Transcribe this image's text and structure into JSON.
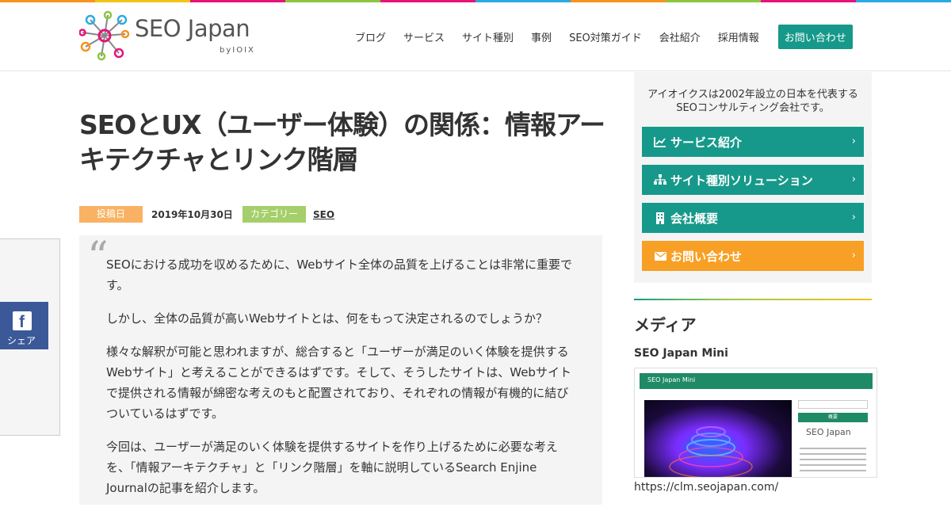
{
  "colors": {
    "stripe": [
      "#f7931e",
      "#f0c419",
      "#e5137a",
      "#8cc63f",
      "#e5137a",
      "#29abe2",
      "#f7931e",
      "#8cc63f",
      "#e5137a",
      "#29abe2"
    ],
    "teal": "#16998a",
    "orange": "#f7a025",
    "date_badge": "#f9b263",
    "category_badge": "#a5cf6a",
    "facebook": "#3b5998"
  },
  "header": {
    "logo_text": "SEO Japan",
    "logo_sub": "byIOIX",
    "nav": [
      "ブログ",
      "サービス",
      "サイト種別",
      "事例",
      "SEO対策ガイド",
      "会社紹介",
      "採用情報"
    ],
    "contact_label": "お問い合わせ"
  },
  "article": {
    "title": "SEOとUX（ユーザー体験）の関係：情報アーキテクチャとリンク階層",
    "posted_label": "投稿日",
    "date": "2019年10月30日",
    "category_label": "カテゴリー",
    "category": "SEO",
    "quote_mark": "“",
    "paragraphs": [
      "SEOにおける成功を収めるために、Webサイト全体の品質を上げることは非常に重要です。",
      "しかし、全体の品質が高いWebサイトとは、何をもって決定されるのでしょうか？",
      "様々な解釈が可能と思われますが、総合すると「ユーザーが満足のいく体験を提供するWebサイト」と考えることができるはずです。そして、そうしたサイトは、Webサイトで提供される情報が綿密な考えのもと配置されており、それぞれの情報が有機的に結びついているはずです。",
      "今回は、ユーザーが満足のいく体験を提供するサイトを作り上げるために必要な考えを、「情報アーキテクチャ」と「リンク階層」を軸に説明しているSearch Enjine Journalの記事を紹介します。"
    ]
  },
  "share": {
    "facebook_label": "シェア",
    "facebook_icon": "f"
  },
  "sidebar": {
    "intro_line1": "アイオイクスは2002年設立の日本を代表する",
    "intro_line2": "SEOコンサルティング会社です。",
    "buttons": [
      {
        "label": "サービス紹介",
        "icon": "chart-line-icon"
      },
      {
        "label": "サイト種別ソリューション",
        "icon": "sitemap-icon"
      },
      {
        "label": "会社概要",
        "icon": "building-icon"
      },
      {
        "label": "お問い合わせ",
        "icon": "envelope-icon"
      }
    ],
    "chevron": "›",
    "media_heading": "メディア",
    "mini_label": "SEO Japan Mini",
    "thumb_bar_text": "SEO Japan Mini",
    "thumb_side_heading": "概要",
    "thumb_logo": "SEO Japan",
    "url": "https://clm.seojapan.com/"
  }
}
